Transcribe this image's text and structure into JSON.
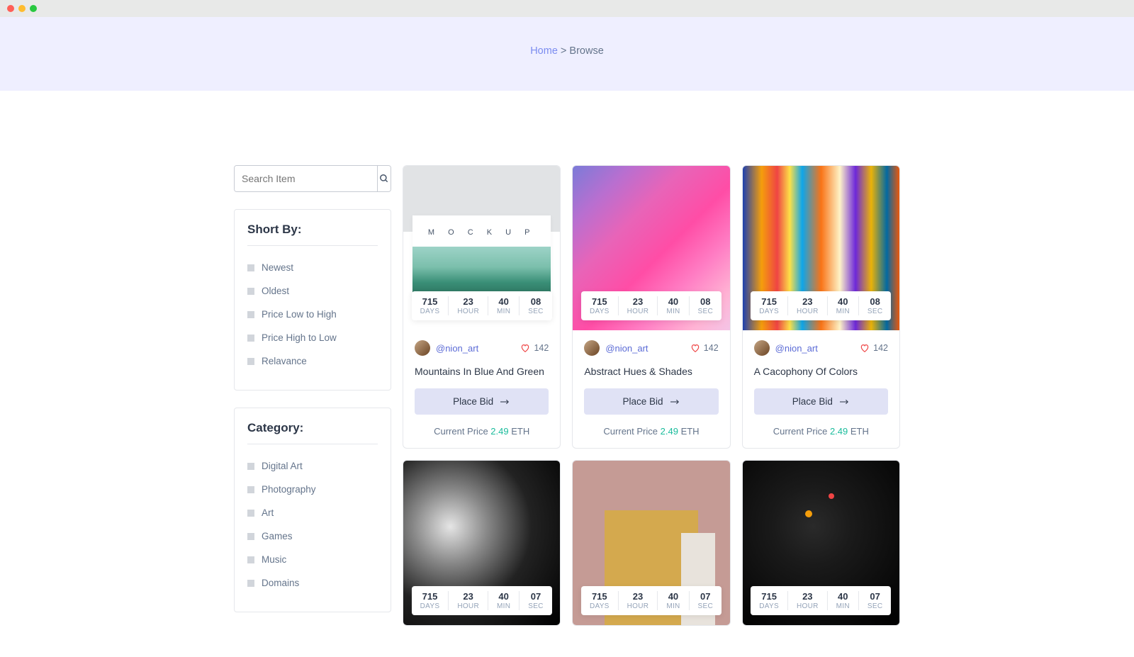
{
  "breadcrumb": {
    "home": "Home",
    "sep": ">",
    "current": "Browse"
  },
  "search": {
    "placeholder": "Search Item"
  },
  "sort": {
    "title": "Short By:",
    "items": [
      "Newest",
      "Oldest",
      "Price Low to High",
      "Price High to Low",
      "Relavance"
    ]
  },
  "category": {
    "title": "Category:",
    "items": [
      "Digital Art",
      "Photography",
      "Art",
      "Games",
      "Music",
      "Domains"
    ]
  },
  "timer_labels": {
    "days": "DAYS",
    "hour": "HOUR",
    "min": "MIN",
    "sec": "SEC"
  },
  "common": {
    "handle": "@nion_art",
    "likes": "142",
    "bid_label": "Place Bid",
    "price_label": "Current Price",
    "price_amt": "2.49",
    "price_unit": "ETH"
  },
  "cards": [
    {
      "title": "Mountains In Blue And Green",
      "days": "715",
      "hour": "23",
      "min": "40",
      "sec": "08"
    },
    {
      "title": "Abstract Hues & Shades",
      "days": "715",
      "hour": "23",
      "min": "40",
      "sec": "08"
    },
    {
      "title": "A Cacophony Of Colors",
      "days": "715",
      "hour": "23",
      "min": "40",
      "sec": "08"
    },
    {
      "title": "",
      "days": "715",
      "hour": "23",
      "min": "40",
      "sec": "07"
    },
    {
      "title": "",
      "days": "715",
      "hour": "23",
      "min": "40",
      "sec": "07"
    },
    {
      "title": "",
      "days": "715",
      "hour": "23",
      "min": "40",
      "sec": "07"
    }
  ]
}
